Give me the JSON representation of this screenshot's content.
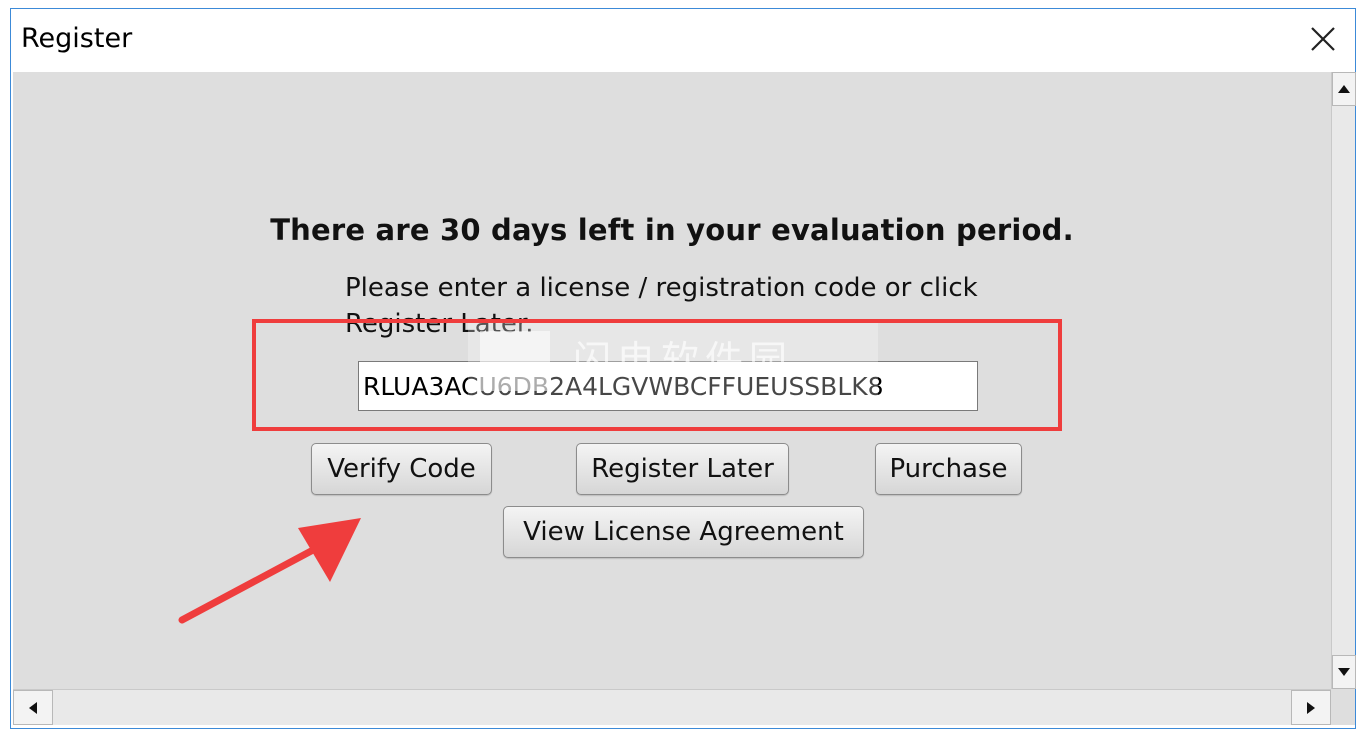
{
  "window": {
    "title": "Register"
  },
  "dialog": {
    "headline": "There are 30 days left in your evaluation period.",
    "prompt": "Please enter a license / registration code or click Register Later.",
    "license_code_value": "RLUA3ACU6DB2A4LGVWBCFFUEUSSBLK8",
    "watermark_text": "闪电软件园"
  },
  "buttons": {
    "verify_code": "Verify Code",
    "register_later": "Register Later",
    "purchase": "Purchase",
    "view_license": "View License Agreement"
  },
  "annotations": {
    "highlight_color": "#ef3d3d",
    "arrow_color": "#ef3d3d"
  },
  "icons": {
    "close": "close-icon",
    "scroll_up": "arrow-up-icon",
    "scroll_down": "arrow-down-icon",
    "scroll_left": "arrow-left-icon",
    "scroll_right": "arrow-right-icon"
  }
}
